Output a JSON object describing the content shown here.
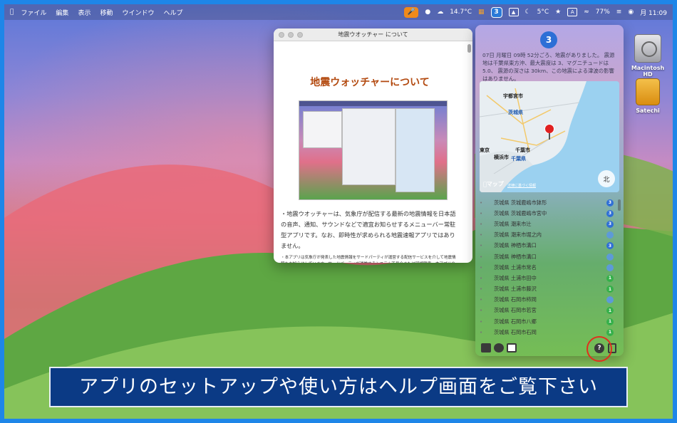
{
  "menubar": {
    "items": [
      "ファイル",
      "編集",
      "表示",
      "移動",
      "ウインドウ",
      "ヘルプ"
    ],
    "status": {
      "temp1": "14.7°C",
      "badge_count": "3",
      "temp2": "5°C",
      "key_letter": "A",
      "battery": "77%",
      "clock": "月 11:09"
    }
  },
  "desktop_icons": [
    {
      "label": "Macintosh HD",
      "icon": "hard-drive-icon"
    },
    {
      "label": "Satechi",
      "icon": "external-drive-icon"
    }
  ],
  "help_window": {
    "title": "地震ウオッチャー について",
    "heading": "地震ウォッチャーについて",
    "body": "・地震ウオッチャーは、気象庁が配信する最新の地震情報を日本語の音声、通知、サウンドなどで適宜お知らせするメニューバー常駐型アプリです。なお、即時性が求められる地震速報アプリではありません。",
    "notes": "・本アプリは気象庁が発表した地震情報をサードパーティが運営する配信サービスを介して地震情報をお知らせしています。サードパーティが運営するシステム不具合または回線障害、本アプリの不具合ほかの事由で情報を受信できない場合がありますので、予めご了承下さい。・本アプリで提供する地震情報は地震速報ではなく、ある程度情報が収集できた後に発生し"
  },
  "quake_panel": {
    "count": "3",
    "info": "07日 月曜日 09時 52分ごろ、地震がありました。 震源地は千葉県東方沖、最大震度は 3、マグニチュードは 5.0、 震源の深さは 30km、この地震による津波の影響はありません。",
    "map": {
      "labels": [
        "宇都宮市",
        "茨城県",
        "東京",
        "横浜市",
        "千葉市",
        "千葉県"
      ],
      "brand": "マップ",
      "legal": "法律に基づく情報",
      "compass": "北"
    },
    "list": [
      {
        "label": "茨城県 茨城鹿嶋市鉢形",
        "badge": "3",
        "color": "#2f6fd6"
      },
      {
        "label": "茨城県 茨城鹿嶋市宮中",
        "badge": "3",
        "color": "#2f6fd6"
      },
      {
        "label": "茨城県 潮来市辻",
        "badge": "3",
        "color": "#2f6fd6"
      },
      {
        "label": "茨城県 潮来市堀之内",
        "badge": "",
        "color": "#5d9ad8"
      },
      {
        "label": "茨城県 神栖市溝口",
        "badge": "3",
        "color": "#2f6fd6"
      },
      {
        "label": "茨城県 神栖市溝口",
        "badge": "",
        "color": "#5d9ad8"
      },
      {
        "label": "茨城県 土浦市常名",
        "badge": "",
        "color": "#5d9ad8"
      },
      {
        "label": "茨城県 土浦市田中",
        "badge": "1",
        "color": "#35b04a"
      },
      {
        "label": "茨城県 土浦市藤沢",
        "badge": "1",
        "color": "#35b04a"
      },
      {
        "label": "茨城県 石岡市柿岡",
        "badge": "",
        "color": "#5d9ad8"
      },
      {
        "label": "茨城県 石岡市若宮",
        "badge": "1",
        "color": "#35b04a"
      },
      {
        "label": "茨城県 石岡市八郷",
        "badge": "1",
        "color": "#35b04a"
      },
      {
        "label": "茨城県 石岡市石岡",
        "badge": "1",
        "color": "#35b04a"
      }
    ],
    "help_label": "?"
  },
  "caption": "アプリのセットアップや使い方はヘルプ画面をご覧下さい",
  "colors": {
    "frame": "#1e86e8",
    "caption_bg": "#0b3a85",
    "highlight_ring": "#e0301d"
  }
}
